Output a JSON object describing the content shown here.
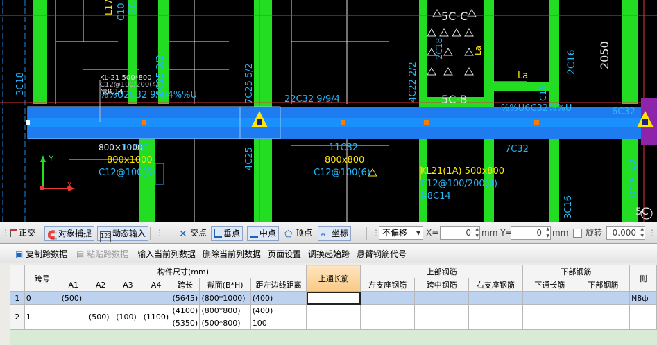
{
  "cad": {
    "labels": [
      {
        "text": "L17",
        "color": "yellow",
        "rotate": -90
      },
      {
        "text": "C10",
        "color": "cyan",
        "rotate": -90
      },
      {
        "text": "2C",
        "color": "cyan",
        "rotate": -90
      },
      {
        "text": "5C-C",
        "color": "white",
        "rotate": 0
      },
      {
        "text": "2C18",
        "color": "cyan",
        "rotate": -90
      },
      {
        "text": "La",
        "color": "yellow",
        "rotate": -90
      },
      {
        "text": "2C16",
        "color": "cyan",
        "rotate": -90
      },
      {
        "text": "2050",
        "color": "white",
        "rotate": -90
      },
      {
        "text": "3C18",
        "color": "cyan",
        "rotate": -90
      },
      {
        "text": "KL-21 500*800",
        "color": "white",
        "rotate": 0
      },
      {
        "text": "C12@100/200(4)",
        "color": "white",
        "rotate": 0
      },
      {
        "text": "N8C14",
        "color": "white",
        "rotate": 0
      },
      {
        "text": "%%U2C32 9/9/4%%U",
        "color": "cyan",
        "rotate": 0
      },
      {
        "text": "8C25 3/2",
        "color": "cyan",
        "rotate": -90
      },
      {
        "text": "7C25 5/2",
        "color": "cyan",
        "rotate": -90
      },
      {
        "text": "22C32 9/9/4",
        "color": "cyan",
        "rotate": 0
      },
      {
        "text": "4C22 2/2",
        "color": "cyan",
        "rotate": -90
      },
      {
        "text": "5C-B",
        "color": "white",
        "rotate": 0
      },
      {
        "text": "La",
        "color": "yellow",
        "rotate": 0
      },
      {
        "text": "C16",
        "color": "cyan",
        "rotate": -90
      },
      {
        "text": "%%U6C32%%U",
        "color": "cyan",
        "rotate": 0
      },
      {
        "text": "6C32",
        "color": "cyan",
        "rotate": 0
      },
      {
        "text": "800×1000",
        "color": "white",
        "rotate": 0
      },
      {
        "text": "11C32",
        "color": "cyan",
        "rotate": 0
      },
      {
        "text": "800x1000",
        "color": "yellow",
        "rotate": 0
      },
      {
        "text": "C12@100(6)",
        "color": "cyan",
        "rotate": 0
      },
      {
        "text": "4C25",
        "color": "cyan",
        "rotate": -90
      },
      {
        "text": "11C32",
        "color": "cyan",
        "rotate": 0
      },
      {
        "text": "800x800",
        "color": "yellow",
        "rotate": 0
      },
      {
        "text": "C12@100(6)",
        "color": "cyan",
        "rotate": 0
      },
      {
        "text": "KL21(1A) 500x800",
        "color": "yellow",
        "rotate": 0
      },
      {
        "text": "C12@100/200(4)",
        "color": "cyan",
        "rotate": 0
      },
      {
        "text": "N8C14",
        "color": "cyan",
        "rotate": 0
      },
      {
        "text": "7C32",
        "color": "cyan",
        "rotate": 0
      },
      {
        "text": "7C25 5/2",
        "color": "cyan",
        "rotate": -90
      },
      {
        "text": "3C16",
        "color": "cyan",
        "rotate": -90
      },
      {
        "text": "5C",
        "color": "white",
        "rotate": 0
      }
    ],
    "axis": {
      "y": "Y",
      "x": "X"
    }
  },
  "snapbar": {
    "ortho": "正交",
    "object_snap": "对象捕捉",
    "dynamic_input": "动态输入",
    "intersection": "交点",
    "perpendicular": "垂点",
    "midpoint": "中点",
    "vertex": "顶点",
    "coordinate": "坐标",
    "offset_mode": "不偏移",
    "x_label": "X=",
    "x_value": "0",
    "y_label": "mm Y=",
    "y_value": "0",
    "mm": "mm",
    "rotate_label": "旋转",
    "rotate_value": "0.000"
  },
  "panel_toolbar": {
    "copy": "复制跨数据",
    "paste": "粘贴跨数据",
    "input_col": "输入当前列数据",
    "delete_col": "删除当前列数据",
    "page_setup": "页面设置",
    "swap_start": "调换起始跨",
    "cantilever": "悬臂钢筋代号"
  },
  "table": {
    "h_span": "跨号",
    "h_dims": "构件尺寸(mm)",
    "h_a1": "A1",
    "h_a2": "A2",
    "h_a3": "A3",
    "h_a4": "A4",
    "h_len": "跨长",
    "h_sect": "截面(B*H)",
    "h_dist": "距左边线距离",
    "h_top_through": "上通长筋",
    "h_top_bars": "上部钢筋",
    "h_left_support": "左支座钢筋",
    "h_mid_span": "跨中钢筋",
    "h_right_support": "右支座钢筋",
    "h_bottom_bars": "下部钢筋",
    "h_bottom_through": "下通长筋",
    "h_bottom_sub": "下部钢筋",
    "h_side": "侧",
    "rows": [
      {
        "num": "1",
        "span": "0",
        "a1": "(500)",
        "a2": "",
        "a3": "",
        "a4": "",
        "len": "(5645)",
        "sect": "(800*1000)",
        "dist": "(400)",
        "side": "N8ф"
      },
      {
        "num": "2",
        "span": "1",
        "a1": "",
        "a2": "(500)",
        "a3": "(100)",
        "a4": "(1100)",
        "len": "(4100)",
        "len2": "(5350)",
        "sect": "(800*800)",
        "sect2": "(500*800)",
        "dist": "(400)",
        "dist2": "100"
      }
    ]
  }
}
